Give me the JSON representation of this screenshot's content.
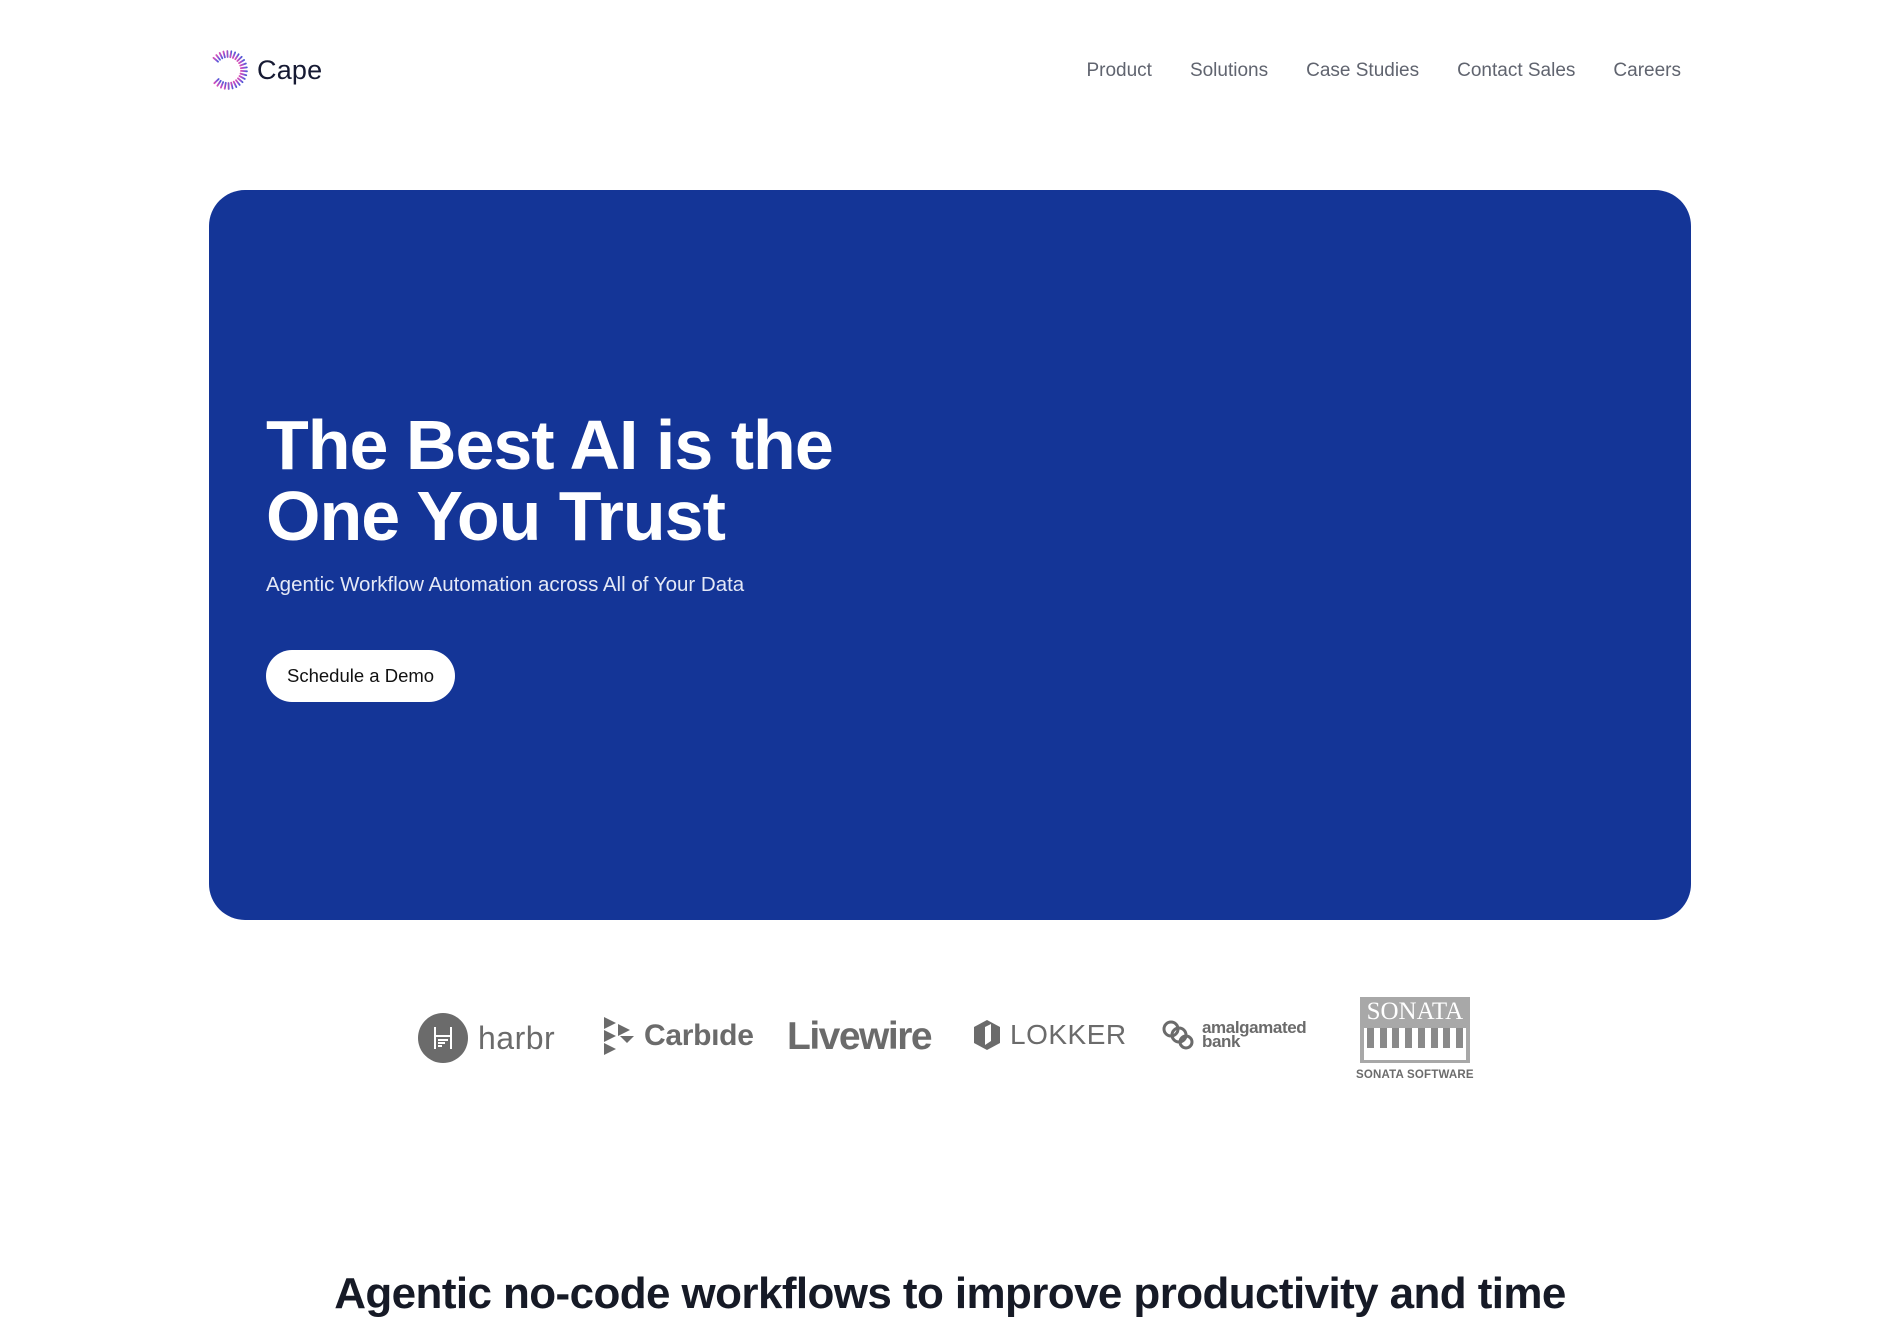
{
  "brand": {
    "name": "Cape",
    "logo_icon": "dashed-arc-logo-icon",
    "accent_gradient": [
      "#d94fb6",
      "#8e52d6",
      "#4b5bd6"
    ]
  },
  "nav": {
    "items": [
      {
        "label": "Product"
      },
      {
        "label": "Solutions"
      },
      {
        "label": "Case Studies"
      },
      {
        "label": "Contact Sales"
      },
      {
        "label": "Careers"
      }
    ]
  },
  "hero": {
    "title_line1": "The Best AI is the",
    "title_line2": "One You Trust",
    "subtitle": "Agentic Workflow Automation across All of Your Data",
    "cta_label": "Schedule a Demo",
    "background_color": "#143597"
  },
  "clients": {
    "logos": [
      {
        "name": "harbr",
        "icon": "harbr-ladder-icon"
      },
      {
        "name": "Carbıde",
        "icon": "carbide-triangles-icon"
      },
      {
        "name": "Livewire"
      },
      {
        "name": "LOKKER",
        "icon": "lokker-hexagon-icon"
      },
      {
        "name_line1": "amalgamated",
        "name_line2": "bank",
        "icon": "amalgamated-rings-icon"
      },
      {
        "name": "SONATA",
        "caption": "SONATA SOFTWARE",
        "icon": "piano-keys-icon"
      }
    ]
  },
  "section": {
    "title": "Agentic no-code workflows to improve productivity and time"
  }
}
